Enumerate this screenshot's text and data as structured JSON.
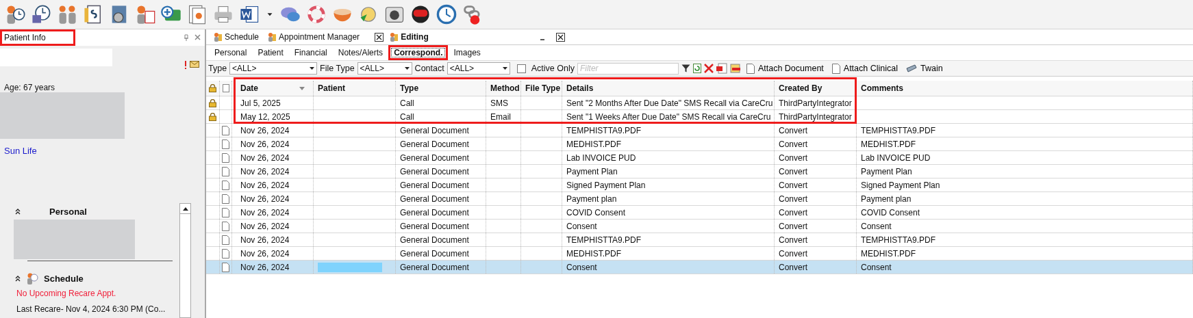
{
  "patient_panel": {
    "title": "Patient Info",
    "title_highlighted": true,
    "age": "Age: 67 years",
    "insurer": "Sun Life",
    "sections": [
      {
        "title": "Personal",
        "expanded": true,
        "kind": "personal"
      },
      {
        "title": "Schedule",
        "expanded": true,
        "kind": "schedule"
      }
    ],
    "recare_notice": "No Upcoming Recare Appt.",
    "last_recare": "Last Recare- Nov 4, 2024 6:30 PM (Co..."
  },
  "document_tabs": [
    {
      "label": "Schedule",
      "selected": false,
      "closable": false
    },
    {
      "label": "Appointment Manager",
      "selected": false,
      "closable": true
    },
    {
      "label": "Editing",
      "selected": true,
      "closable": true
    }
  ],
  "sub_tabs": [
    {
      "label": "Personal",
      "selected": false,
      "highlighted": false
    },
    {
      "label": "Patient",
      "selected": false,
      "highlighted": false
    },
    {
      "label": "Financial",
      "selected": false,
      "highlighted": false
    },
    {
      "label": "Notes/Alerts",
      "selected": false,
      "highlighted": false
    },
    {
      "label": "Correspond.",
      "selected": true,
      "highlighted": true
    },
    {
      "label": "Images",
      "selected": false,
      "highlighted": false
    }
  ],
  "filters": [
    {
      "label": "Type",
      "value": "<ALL>"
    },
    {
      "label": "File Type",
      "value": "<ALL>"
    },
    {
      "label": "Contact",
      "value": "<ALL>"
    }
  ],
  "active_only": {
    "label": "Active Only",
    "checked": false
  },
  "filter_field": {
    "placeholder": "Filter"
  },
  "actions": [
    "Attach Document",
    "Attach Clinical",
    "Twain"
  ],
  "table": {
    "columns": [
      {
        "label": "Date",
        "sorted": true
      },
      {
        "label": "Patient",
        "sorted": false
      },
      {
        "label": "Type",
        "sorted": false
      },
      {
        "label": "Method",
        "sorted": false
      },
      {
        "label": "File Type",
        "sorted": false
      },
      {
        "label": "Details",
        "sorted": false
      },
      {
        "label": "Created By",
        "sorted": false
      },
      {
        "label": "Comments",
        "sorted": false
      }
    ],
    "rows": [
      {
        "kind": "locked",
        "selected": false,
        "highlighted": true,
        "date": "Jul 5, 2025",
        "type": "Call",
        "method": "SMS",
        "details": "Sent \"2 Months After Due Date\" SMS Recall via CareCru",
        "created_by": "ThirdPartyIntegrator"
      },
      {
        "kind": "locked",
        "selected": false,
        "highlighted": true,
        "date": "May 12, 2025",
        "type": "Call",
        "method": "Email",
        "details": "Sent \"1 Weeks After Due Date\" SMS Recall via CareCru",
        "created_by": "ThirdPartyIntegrator"
      },
      {
        "kind": "document",
        "selected": false,
        "highlighted": false,
        "date": "Nov 26, 2024",
        "type": "General Document",
        "details": "TEMPHISTTA9.PDF",
        "created_by": "Convert",
        "comments": "TEMPHISTTA9.PDF"
      },
      {
        "kind": "document",
        "selected": false,
        "highlighted": false,
        "date": "Nov 26, 2024",
        "type": "General Document",
        "details": "MEDHIST.PDF",
        "created_by": "Convert",
        "comments": "MEDHIST.PDF"
      },
      {
        "kind": "document",
        "selected": false,
        "highlighted": false,
        "date": "Nov 26, 2024",
        "type": "General Document",
        "details": "Lab INVOICE  PUD",
        "created_by": "Convert",
        "comments": "Lab INVOICE  PUD"
      },
      {
        "kind": "document",
        "selected": false,
        "highlighted": false,
        "date": "Nov 26, 2024",
        "type": "General Document",
        "details": "Payment Plan",
        "created_by": "Convert",
        "comments": "Payment Plan"
      },
      {
        "kind": "document",
        "selected": false,
        "highlighted": false,
        "date": "Nov 26, 2024",
        "type": "General Document",
        "details": "Signed Payment Plan",
        "created_by": "Convert",
        "comments": "Signed Payment Plan"
      },
      {
        "kind": "document",
        "selected": false,
        "highlighted": false,
        "date": "Nov 26, 2024",
        "type": "General Document",
        "details": "Payment plan",
        "created_by": "Convert",
        "comments": "Payment plan"
      },
      {
        "kind": "document",
        "selected": false,
        "highlighted": false,
        "date": "Nov 26, 2024",
        "type": "General Document",
        "details": "COVID Consent",
        "created_by": "Convert",
        "comments": "COVID Consent"
      },
      {
        "kind": "document",
        "selected": false,
        "highlighted": false,
        "date": "Nov 26, 2024",
        "type": "General Document",
        "details": "Consent",
        "created_by": "Convert",
        "comments": "Consent"
      },
      {
        "kind": "document",
        "selected": false,
        "highlighted": false,
        "date": "Nov 26, 2024",
        "type": "General Document",
        "details": "TEMPHISTTA9.PDF",
        "created_by": "Convert",
        "comments": "TEMPHISTTA9.PDF"
      },
      {
        "kind": "document",
        "selected": false,
        "highlighted": false,
        "date": "Nov 26, 2024",
        "type": "General Document",
        "details": "MEDHIST.PDF",
        "created_by": "Convert",
        "comments": "MEDHIST.PDF"
      },
      {
        "kind": "document",
        "selected": true,
        "highlighted": false,
        "date": "Nov 26, 2024",
        "type": "General Document",
        "details": "Consent",
        "created_by": "Convert",
        "comments": "Consent"
      }
    ]
  }
}
